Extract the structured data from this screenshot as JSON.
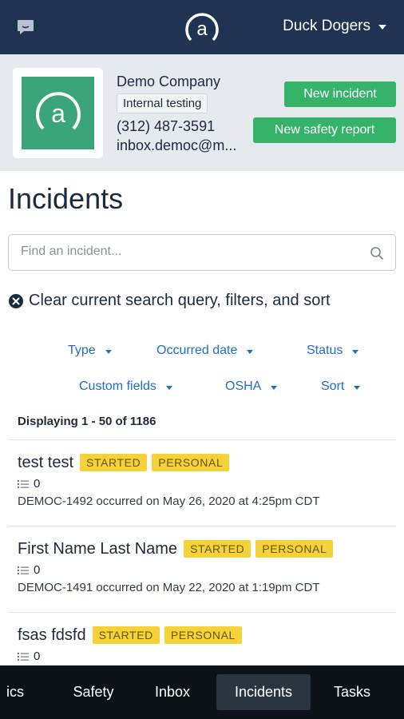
{
  "header": {
    "chat_icon": "chat-bubble-icon",
    "logo_letter": "a",
    "user_name": "Duck Dogers"
  },
  "company": {
    "logo_letter": "a",
    "name": "Demo Company",
    "tag": "Internal testing",
    "phone": "(312) 487-3591",
    "email": "inbox.democ@m...",
    "new_incident_label": "New incident",
    "new_safety_label": "New safety report"
  },
  "page": {
    "title": "Incidents",
    "search_placeholder": "Find an incident...",
    "clear_label": "Clear current search query, filters, and sort"
  },
  "filters": {
    "type": "Type",
    "occurred_date": "Occurred date",
    "status": "Status",
    "custom_fields": "Custom fields",
    "osha": "OSHA",
    "sort": "Sort"
  },
  "results": {
    "displaying": "Displaying 1 - 50 of 1186"
  },
  "incidents": [
    {
      "title": "test test",
      "status": "STARTED",
      "category": "PERSONAL",
      "count": "0",
      "summary": "DEMOC-1492 occurred on May 26, 2020 at 4:25pm CDT"
    },
    {
      "title": "First Name Last Name",
      "status": "STARTED",
      "category": "PERSONAL",
      "count": "0",
      "summary": "DEMOC-1491 occurred on May 22, 2020 at 1:19pm CDT"
    },
    {
      "title": "fsas fdsfd",
      "status": "STARTED",
      "category": "PERSONAL",
      "count": "0",
      "summary": ""
    }
  ],
  "tabs": [
    {
      "label": "ics"
    },
    {
      "label": "Safety"
    },
    {
      "label": "Inbox"
    },
    {
      "label": "Incidents"
    },
    {
      "label": "Tasks"
    }
  ],
  "colors": {
    "navy": "#1e3452",
    "green": "#34b369",
    "badge_yellow": "#f5d13a",
    "link_blue": "#1f6fc5"
  }
}
